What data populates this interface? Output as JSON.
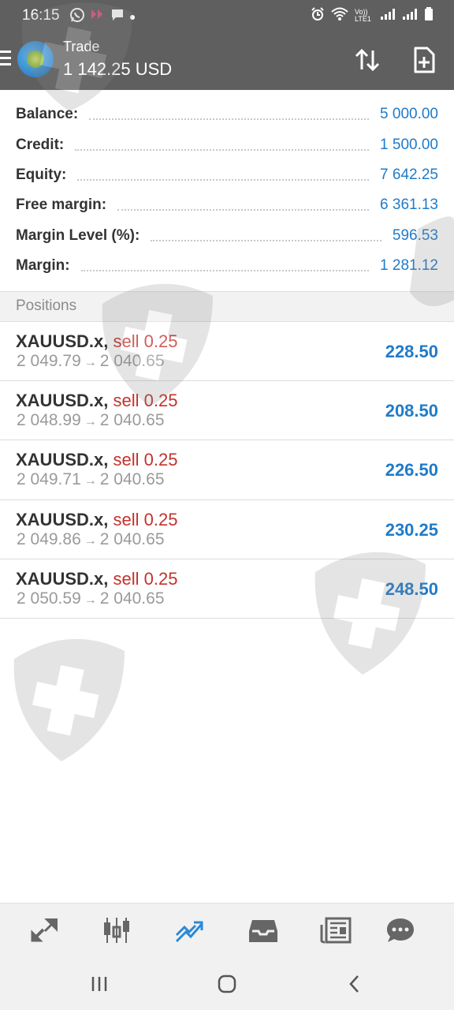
{
  "status_bar": {
    "time": "16:15",
    "network_label": "Vo)) LTE1"
  },
  "header": {
    "title": "Trade",
    "balance": "1 142.25 USD"
  },
  "account": {
    "rows": [
      {
        "label": "Balance:",
        "value": "5 000.00"
      },
      {
        "label": "Credit:",
        "value": "1 500.00"
      },
      {
        "label": "Equity:",
        "value": "7 642.25"
      },
      {
        "label": "Free margin:",
        "value": "6 361.13"
      },
      {
        "label": "Margin Level (%):",
        "value": "596.53"
      },
      {
        "label": "Margin:",
        "value": "1 281.12"
      }
    ]
  },
  "positions": {
    "title": "Positions",
    "items": [
      {
        "symbol": "XAUUSD.x,",
        "side": "sell 0.25",
        "open": "2 049.79",
        "current": "2 040.65",
        "profit": "228.50"
      },
      {
        "symbol": "XAUUSD.x,",
        "side": "sell 0.25",
        "open": "2 048.99",
        "current": "2 040.65",
        "profit": "208.50"
      },
      {
        "symbol": "XAUUSD.x,",
        "side": "sell 0.25",
        "open": "2 049.71",
        "current": "2 040.65",
        "profit": "226.50"
      },
      {
        "symbol": "XAUUSD.x,",
        "side": "sell 0.25",
        "open": "2 049.86",
        "current": "2 040.65",
        "profit": "230.25"
      },
      {
        "symbol": "XAUUSD.x,",
        "side": "sell 0.25",
        "open": "2 050.59",
        "current": "2 040.65",
        "profit": "248.50"
      }
    ]
  },
  "bottom_nav": {
    "items": [
      {
        "icon": "quotes-icon"
      },
      {
        "icon": "chart-icon"
      },
      {
        "icon": "trade-icon",
        "active": true
      },
      {
        "icon": "history-icon"
      },
      {
        "icon": "news-icon"
      },
      {
        "icon": "messages-icon"
      }
    ]
  },
  "colors": {
    "header_bg": "#5f5f5f",
    "value_blue": "#1f7bc9",
    "sell_red": "#c4312b",
    "active_nav": "#2a8ad8"
  }
}
